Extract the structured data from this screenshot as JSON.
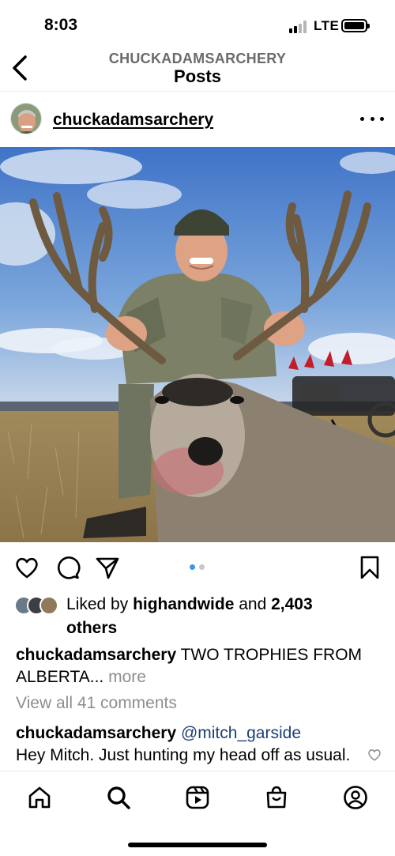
{
  "status_bar": {
    "time": "8:03",
    "network": "LTE"
  },
  "header": {
    "account": "CHUCKADAMSARCHERY",
    "title": "Posts"
  },
  "post": {
    "author": "chuckadamsarchery",
    "carousel": {
      "current": 1,
      "total": 2
    },
    "likes": {
      "prefix": "Liked by ",
      "user": "highandwide",
      "joiner": " and ",
      "count": "2,403",
      "suffix": "others"
    },
    "caption": {
      "user": "chuckadamsarchery",
      "text": " TWO TROPHIES FROM ALBERTA... ",
      "more": "more"
    },
    "view_comments": "View all 41 comments",
    "comment": {
      "user": "chuckadamsarchery",
      "mention": " @mitch_garside",
      "text": "Hey Mitch.  Just hunting my head off as usual. Good to see you the Sunday"
    }
  },
  "icons": [
    "back-icon",
    "more-icon",
    "heart-icon",
    "comment-icon",
    "share-icon",
    "bookmark-icon",
    "home-icon",
    "search-icon",
    "reels-icon",
    "shop-icon",
    "profile-icon"
  ],
  "colors": {
    "accent_dot": "#3897f0",
    "muted": "#8e8e8e",
    "mention": "#1c3f74"
  }
}
